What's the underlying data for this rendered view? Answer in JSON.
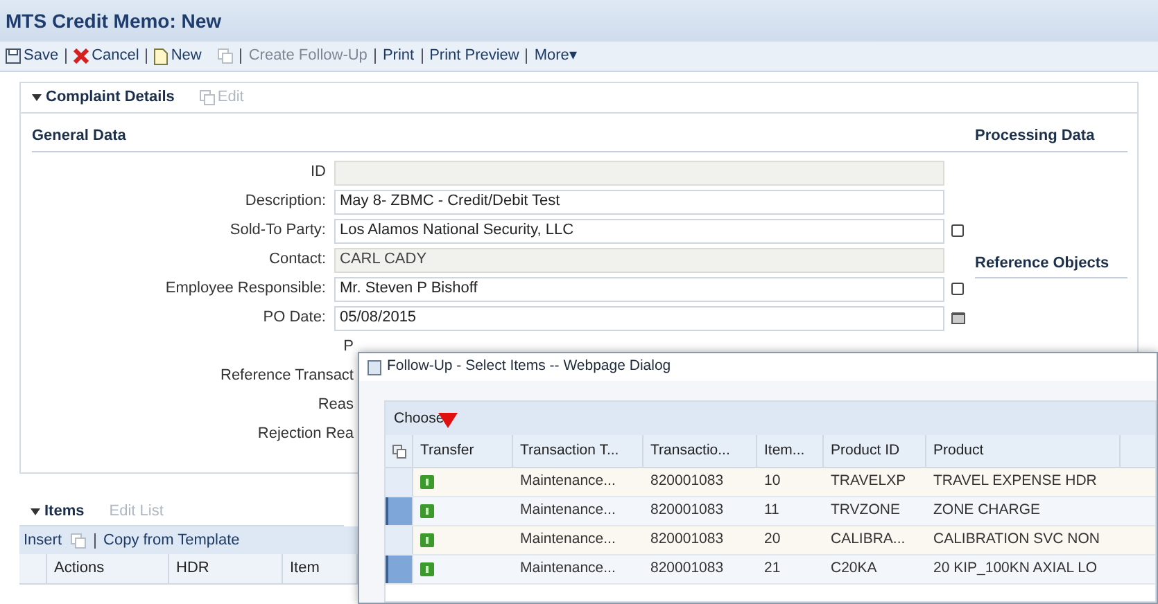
{
  "window": {
    "title": "MTS Credit Memo: New"
  },
  "toolbar": [
    {
      "label": "Save",
      "kind": "save",
      "disabled": false
    },
    {
      "label": "Cancel",
      "kind": "cancel",
      "disabled": false
    },
    {
      "label": "New",
      "kind": "new",
      "disabled": false
    },
    {
      "kind": "copy",
      "disabled": true
    },
    {
      "label": "Create Follow-Up",
      "kind": "text",
      "disabled": true
    },
    {
      "label": "Print",
      "kind": "text",
      "disabled": false
    },
    {
      "label": "Print Preview",
      "kind": "text",
      "disabled": false
    },
    {
      "label": "More▾",
      "kind": "text",
      "disabled": false
    }
  ],
  "complaint_details": {
    "title": "Complaint Details",
    "expanded": true,
    "edit_label": "Edit",
    "general_data": {
      "title": "General Data",
      "fields": [
        {
          "label": "ID",
          "kind": "text",
          "disabled": true
        },
        {
          "label": "Description:",
          "value": "May 8- ZBMC - Credit/Debit Test",
          "kind": "text",
          "disabled": false
        },
        {
          "label": "Sold-To Party:",
          "value": "Los Alamos National Security, LLC",
          "kind": "lookup",
          "disabled": false
        },
        {
          "label": "Contact:",
          "value": "CARL CADY",
          "kind": "text",
          "disabled": true
        },
        {
          "label": "Employee Responsible:",
          "value": "Mr. Steven P Bishoff",
          "kind": "lookup",
          "disabled": false
        },
        {
          "label": "PO Date:",
          "value": "05/08/2015",
          "kind": "date",
          "disabled": false
        }
      ],
      "hidden_labels": [
        "P",
        "Reference Transact",
        "Reas",
        "Rejection Rea"
      ]
    },
    "side_sections": [
      "Processing Data",
      "Reference Objects"
    ]
  },
  "items": {
    "title": "Items",
    "expanded": true,
    "edit_label": "Edit List",
    "toolbar": [
      {
        "label": "Insert",
        "kind": "link"
      },
      {
        "kind": "copy"
      },
      {
        "label": "Copy from Template",
        "kind": "link"
      }
    ],
    "columns": [
      "Actions",
      "HDR",
      "Item"
    ]
  },
  "dialog": {
    "title": "Follow-Up - Select Items -- Webpage Dialog",
    "heading": "Choose",
    "columns": [
      "Transfer",
      "Transaction T...",
      "Transactio...",
      "Item...",
      "Product ID",
      "Product"
    ],
    "rows": [
      {
        "selected": false,
        "cells": [
          "",
          "Maintenance...",
          "820001083",
          "10",
          "TRAVELXP",
          "TRAVEL EXPENSE HDR"
        ]
      },
      {
        "selected": true,
        "cells": [
          "",
          "Maintenance...",
          "820001083",
          "11",
          "TRVZONE",
          "ZONE CHARGE"
        ]
      },
      {
        "selected": false,
        "cells": [
          "",
          "Maintenance...",
          "820001083",
          "20",
          "CALIBRA...",
          "CALIBRATION SVC NON"
        ]
      },
      {
        "selected": true,
        "cells": [
          "",
          "Maintenance...",
          "820001083",
          "21",
          "C20KA",
          "20 KIP_100KN AXIAL LO"
        ]
      }
    ]
  }
}
